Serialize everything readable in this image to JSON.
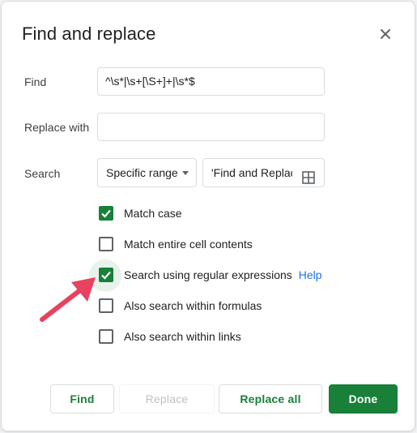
{
  "dialog": {
    "title": "Find and replace",
    "close_icon": "close-icon"
  },
  "find": {
    "label": "Find",
    "value": "^\\s*|\\s+[\\S+]+|\\s*$"
  },
  "replace": {
    "label": "Replace with",
    "value": ""
  },
  "search": {
    "label": "Search",
    "scope_selected": "Specific range",
    "range_value": "'Find and Replace'!",
    "range_icon": "grid-select-icon"
  },
  "options": {
    "match_case": {
      "label": "Match case",
      "checked": true
    },
    "match_entire": {
      "label": "Match entire cell contents",
      "checked": false
    },
    "regex": {
      "label": "Search using regular expressions",
      "checked": true,
      "help": "Help"
    },
    "formulas": {
      "label": "Also search within formulas",
      "checked": false
    },
    "links": {
      "label": "Also search within links",
      "checked": false
    }
  },
  "buttons": {
    "find": "Find",
    "replace": "Replace",
    "replace_all": "Replace all",
    "done": "Done"
  },
  "colors": {
    "accent_green": "#188038",
    "link_blue": "#1a73e8",
    "annotation_arrow": "#e8425f"
  }
}
